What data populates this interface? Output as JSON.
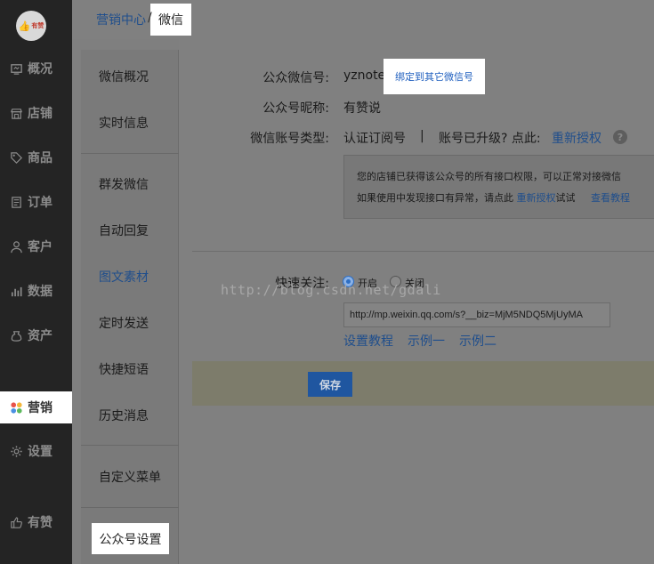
{
  "logo": {
    "text": "有赞"
  },
  "nav": [
    {
      "label": "概况",
      "icon": "overview-icon"
    },
    {
      "label": "店铺",
      "icon": "store-icon"
    },
    {
      "label": "商品",
      "icon": "tag-icon"
    },
    {
      "label": "订单",
      "icon": "order-icon"
    },
    {
      "label": "客户",
      "icon": "user-icon"
    },
    {
      "label": "数据",
      "icon": "bar-chart-icon"
    },
    {
      "label": "资产",
      "icon": "asset-icon"
    },
    {
      "label": "营销",
      "icon": "marketing-icon"
    },
    {
      "label": "设置",
      "icon": "gear-icon"
    },
    {
      "label": "有赞",
      "icon": "thumbs-up-icon"
    }
  ],
  "breadcrumb": {
    "parent": "营销中心",
    "separator": "/",
    "current": "微信"
  },
  "submenu": {
    "items": [
      "微信概况",
      "实时信息",
      "群发微信",
      "自动回复",
      "图文素材",
      "定时发送",
      "快捷短语",
      "历史消息",
      "自定义菜单"
    ],
    "settings": "公众号设置"
  },
  "account": {
    "wechat_id_label": "公众微信号:",
    "wechat_id_value": "yznote",
    "bind_other": "绑定到其它微信号",
    "nickname_label": "公众号昵称:",
    "nickname_value": "有赞说",
    "type_label": "微信账号类型:",
    "type_value": "认证订阅号",
    "type_sep": "|",
    "upgraded_text": "账号已升级? 点此:",
    "reauth": "重新授权",
    "help": "?"
  },
  "notice": {
    "line1": "您的店铺已获得该公众号的所有接口权限，可以正常对接微信",
    "line2_pre": "如果使用中发现接口有异常，请点此",
    "line2_link": "重新授权",
    "line2_post": "试试",
    "tutorial": "查看教程"
  },
  "watermark": "http://blog.csdn.net/gdali",
  "quick_follow": {
    "label": "快速关注:",
    "on": "开启",
    "off": "关闭",
    "url": "http://mp.weixin.qq.com/s?__biz=MjM5NDQ5MjUyMA",
    "tutorial": "设置教程",
    "example1": "示例一",
    "example2": "示例二"
  },
  "save": "保存"
}
